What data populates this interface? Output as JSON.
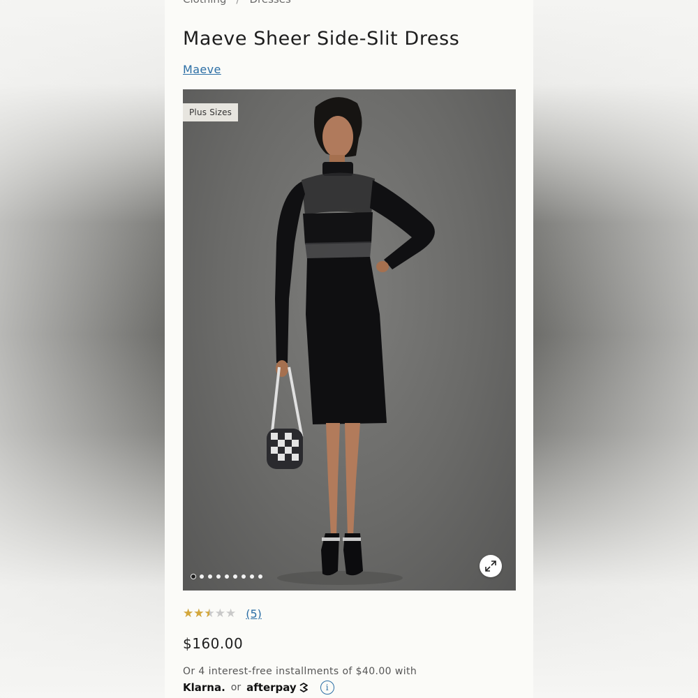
{
  "breadcrumb": {
    "items": [
      "Clothing",
      "Dresses"
    ],
    "separator": "/"
  },
  "product": {
    "title": "Maeve Sheer Side-Slit Dress",
    "brand": "Maeve",
    "badge": "Plus Sizes",
    "image_count": 9,
    "active_image": 1,
    "rating": {
      "value": 2.5,
      "max": 5,
      "stars_glyphs": "★★★★★",
      "review_count_label": "(5)"
    },
    "price": "$160.00",
    "installments_text": "Or 4 interest-free installments of $40.00 with",
    "pay_providers": {
      "klarna": "Klarna.",
      "or": "or",
      "afterpay": "afterpay"
    },
    "info_glyph": "i"
  },
  "icons": [
    "expand-icon",
    "info-icon",
    "afterpay-logo-icon"
  ],
  "colors": {
    "link": "#2b6ea5",
    "star": "#d4a73a",
    "star_empty": "#c9c9c9",
    "page_bg": "#fbfbf8"
  }
}
